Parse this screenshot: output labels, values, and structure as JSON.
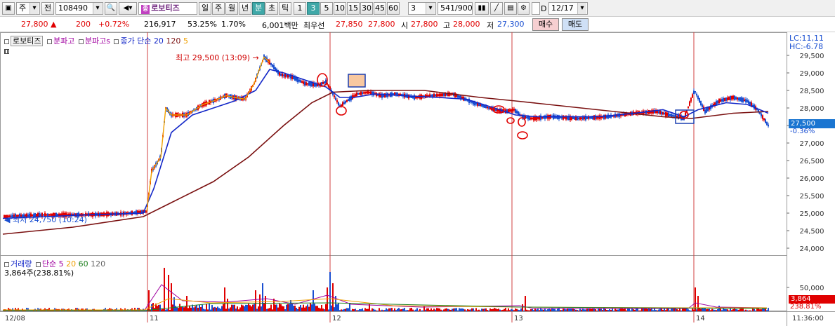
{
  "toolbar": {
    "market_label": "주",
    "prev_label": "전",
    "code_value": "108490",
    "stock_name_badge": "종",
    "stock_name": "로보티즈",
    "period_buttons": [
      "일",
      "주",
      "월",
      "년",
      "분",
      "초",
      "틱"
    ],
    "selected_period": "분",
    "interval_buttons": [
      "1",
      "3",
      "5",
      "10",
      "15",
      "30",
      "45",
      "60"
    ],
    "selected_interval": "3",
    "interval_value": "3",
    "count_value": "541/900",
    "date_checkbox_label": "D",
    "date_value": "12/17"
  },
  "quote": {
    "price": "27,800 ▲",
    "change": "200",
    "change_pct": "+0.72%",
    "volume": "216,917",
    "vol_ratio": "53.25%",
    "turnover_ratio": "1.70%",
    "amount": "6,001백만",
    "best_ask_label": "최우선",
    "best_ask": "27,850",
    "best_bid": "27,800",
    "open_label": "시",
    "open": "27,800",
    "high_label": "고",
    "high": "28,000",
    "low_label": "저",
    "low": "27,300",
    "buy_label": "매수",
    "sell_label": "매도"
  },
  "legend": {
    "stock_name": "로보티즈",
    "ind1": "분파고",
    "ind2": "분파고s",
    "ma_title": "종가 단순",
    "ma1": "20",
    "ma2": "120",
    "ma3": "5",
    "lc_label": "LC:11,11",
    "hc_label": "HC:-6.78",
    "high_annot": "최고 29,500 (13:09)",
    "low_annot": "최저 24,750 (10:24)",
    "vol_title": "거래량",
    "vol_ma_title": "단순",
    "vol_ma1": "5",
    "vol_ma2": "20",
    "vol_ma3": "60",
    "vol_ma4": "120",
    "vol_value": "3,864주(238.81%)"
  },
  "right_tags": {
    "price": "27,500",
    "price_pct": "-0.36%",
    "vol": "3,864",
    "vol_pct": "238.81%"
  },
  "colors": {
    "up": "#e00000",
    "down": "#1a4fd1",
    "ma5": "#f0a000",
    "ma20": "#1428c8",
    "ma120": "#7a1010",
    "day_line": "#d04040"
  },
  "chart_data": {
    "type": "candlestick",
    "y_ticks": [
      "24,000",
      "24,500",
      "25,000",
      "25,500",
      "26,000",
      "26,500",
      "27,000",
      "27,500",
      "28,000",
      "28,500",
      "29,000",
      "29,500"
    ],
    "ylim": [
      23800,
      29800
    ],
    "vol_ticks": [
      "50,000"
    ],
    "x_day_labels": [
      "12/08",
      "11",
      "12",
      "13",
      "14"
    ],
    "time_label": "11:36:00",
    "price_path": [
      [
        0,
        24900
      ],
      [
        60,
        24950
      ],
      [
        110,
        24950
      ],
      [
        170,
        24980
      ],
      [
        205,
        25050
      ],
      [
        212,
        26200
      ],
      [
        225,
        26600
      ],
      [
        232,
        28000
      ],
      [
        240,
        27800
      ],
      [
        262,
        27800
      ],
      [
        285,
        28100
      ],
      [
        300,
        28200
      ],
      [
        318,
        28350
      ],
      [
        330,
        28300
      ],
      [
        345,
        28250
      ],
      [
        358,
        28700
      ],
      [
        372,
        29450
      ],
      [
        380,
        29300
      ],
      [
        395,
        28950
      ],
      [
        410,
        28900
      ],
      [
        430,
        28700
      ],
      [
        450,
        28650
      ],
      [
        460,
        28750
      ],
      [
        465,
        28600
      ],
      [
        470,
        28400
      ],
      [
        480,
        28050
      ],
      [
        490,
        28200
      ],
      [
        505,
        28400
      ],
      [
        520,
        28450
      ],
      [
        540,
        28350
      ],
      [
        560,
        28400
      ],
      [
        585,
        28300
      ],
      [
        610,
        28350
      ],
      [
        640,
        28400
      ],
      [
        670,
        28150
      ],
      [
        700,
        27950
      ],
      [
        715,
        27900
      ],
      [
        728,
        27950
      ],
      [
        740,
        27750
      ],
      [
        752,
        27700
      ],
      [
        780,
        27750
      ],
      [
        820,
        27700
      ],
      [
        860,
        27750
      ],
      [
        900,
        27850
      ],
      [
        930,
        27900
      ],
      [
        950,
        27800
      ],
      [
        970,
        27700
      ],
      [
        985,
        28500
      ],
      [
        1000,
        27900
      ],
      [
        1020,
        28200
      ],
      [
        1040,
        28300
      ],
      [
        1060,
        28200
      ],
      [
        1075,
        27950
      ],
      [
        1090,
        27500
      ]
    ],
    "ma20_path": [
      [
        0,
        24850
      ],
      [
        60,
        24900
      ],
      [
        120,
        24950
      ],
      [
        200,
        25000
      ],
      [
        215,
        25700
      ],
      [
        240,
        27300
      ],
      [
        270,
        27800
      ],
      [
        300,
        28000
      ],
      [
        330,
        28200
      ],
      [
        360,
        28500
      ],
      [
        380,
        29100
      ],
      [
        400,
        29000
      ],
      [
        430,
        28800
      ],
      [
        460,
        28600
      ],
      [
        480,
        28300
      ],
      [
        500,
        28300
      ],
      [
        530,
        28400
      ],
      [
        570,
        28350
      ],
      [
        620,
        28300
      ],
      [
        660,
        28250
      ],
      [
        700,
        28000
      ],
      [
        730,
        27800
      ],
      [
        760,
        27750
      ],
      [
        800,
        27750
      ],
      [
        850,
        27750
      ],
      [
        900,
        27850
      ],
      [
        940,
        27950
      ],
      [
        970,
        27750
      ],
      [
        990,
        27950
      ],
      [
        1030,
        28150
      ],
      [
        1060,
        28100
      ],
      [
        1090,
        27850
      ]
    ],
    "ma120_path": [
      [
        0,
        24400
      ],
      [
        100,
        24600
      ],
      [
        200,
        24900
      ],
      [
        240,
        25300
      ],
      [
        300,
        25900
      ],
      [
        350,
        26600
      ],
      [
        400,
        27500
      ],
      [
        440,
        28150
      ],
      [
        470,
        28450
      ],
      [
        520,
        28500
      ],
      [
        600,
        28500
      ],
      [
        680,
        28300
      ],
      [
        730,
        28200
      ],
      [
        800,
        28050
      ],
      [
        870,
        27900
      ],
      [
        940,
        27750
      ],
      [
        980,
        27700
      ],
      [
        1040,
        27850
      ],
      [
        1090,
        27900
      ]
    ]
  }
}
